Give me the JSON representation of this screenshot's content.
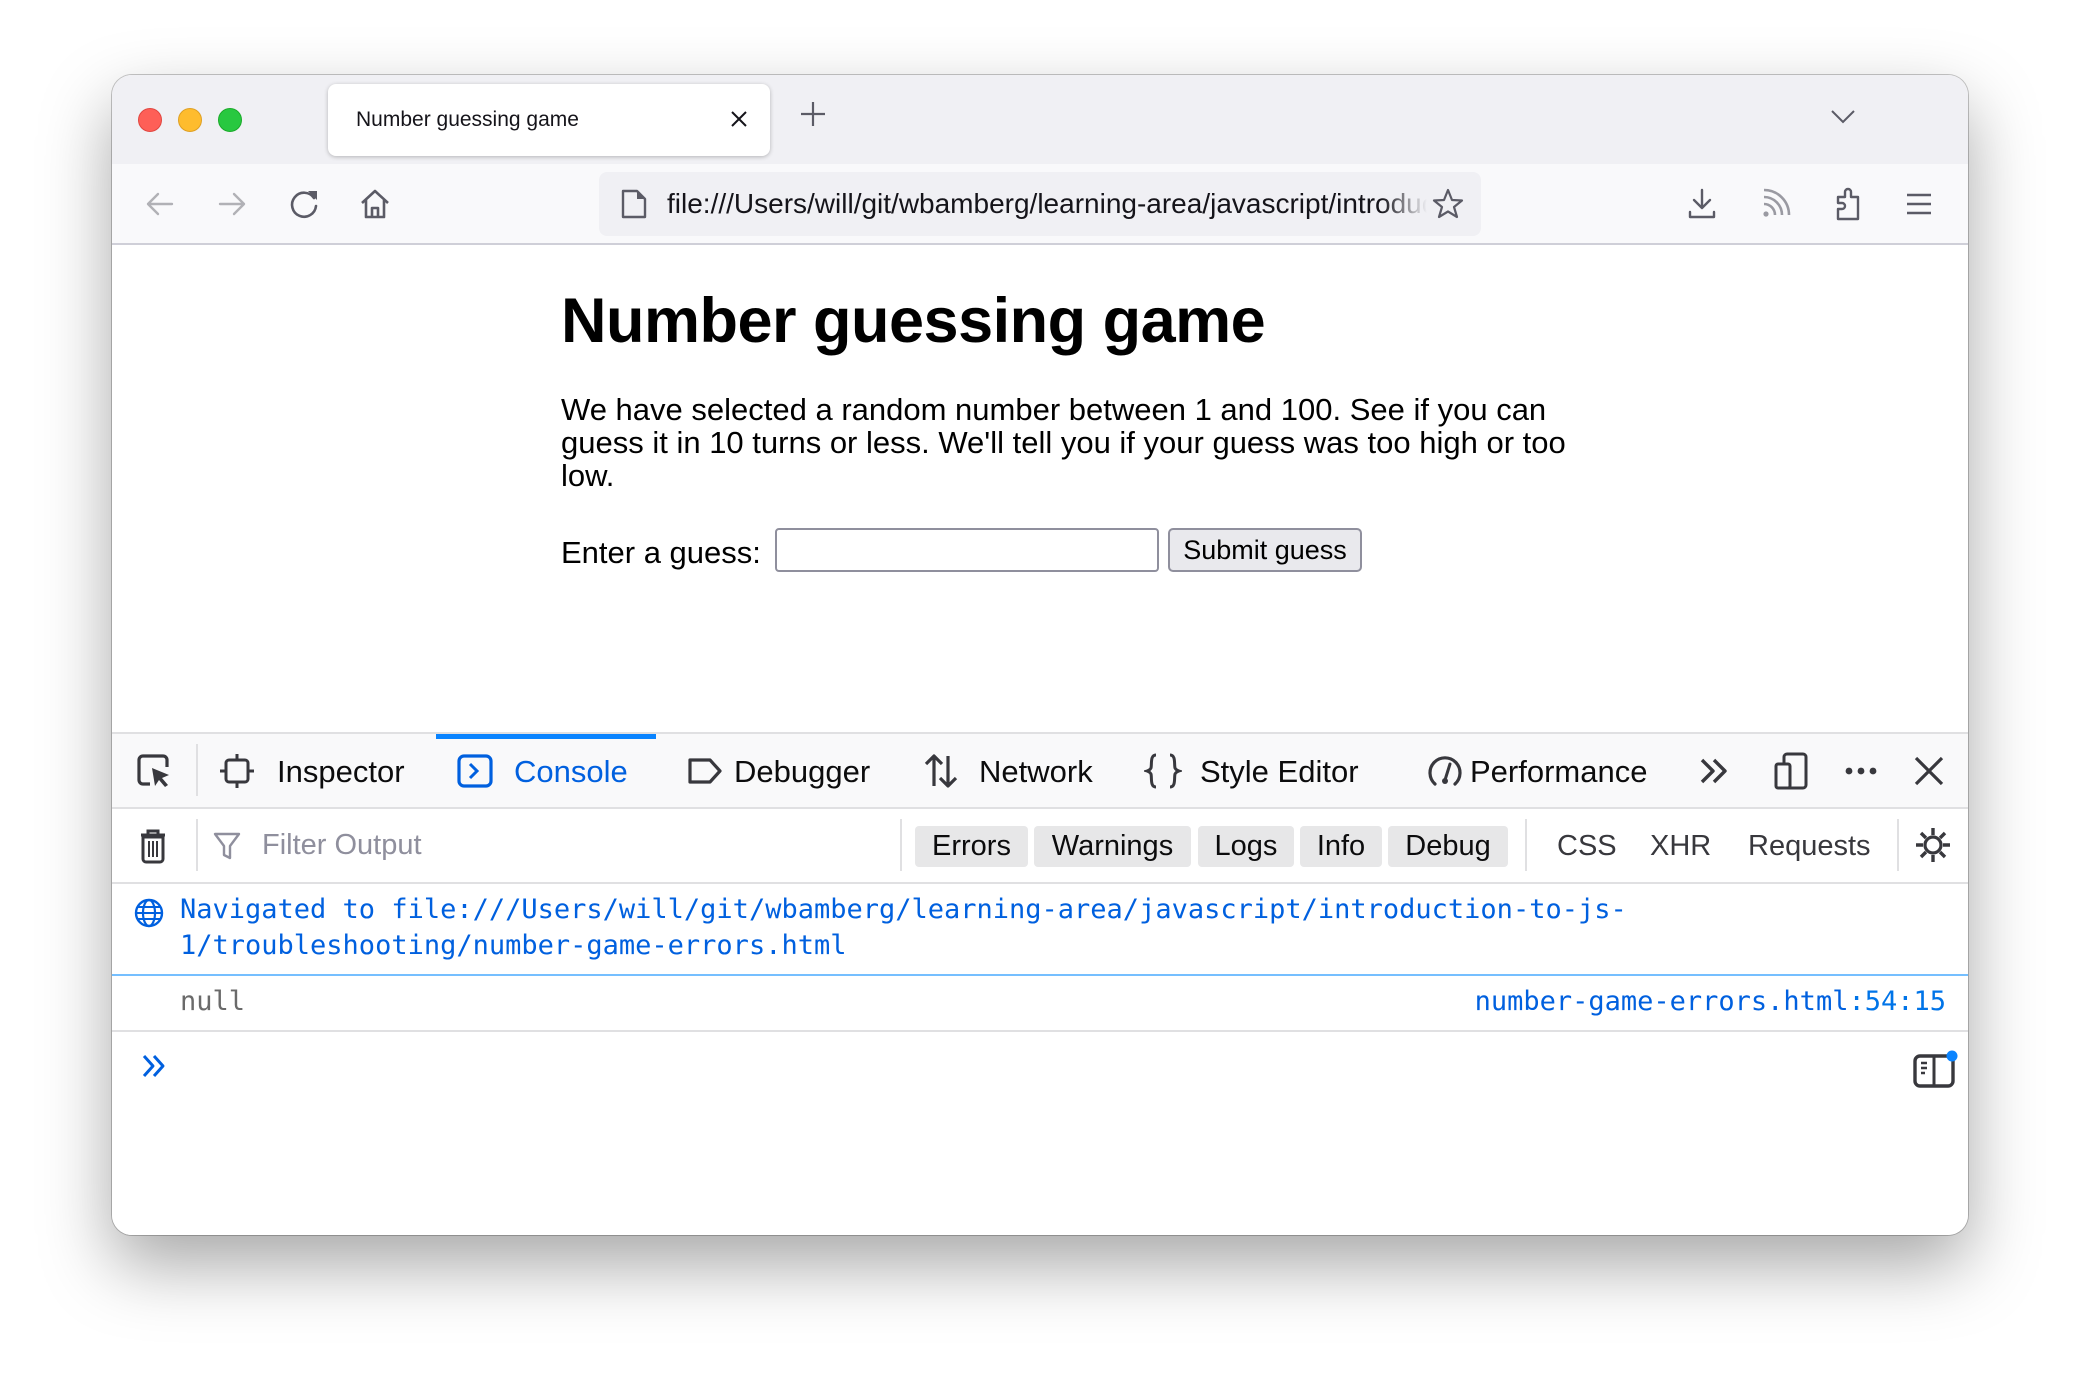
{
  "browser": {
    "tab": {
      "title": "Number guessing game"
    },
    "url": "file:///Users/will/git/wbamberg/learning-area/javascript/introduction-to-js-1/troubleshooting/number-game-errors.html"
  },
  "page": {
    "heading": "Number guessing game",
    "paragraph": "We have selected a random number between 1 and 100. See if you can guess it in 10 turns or less. We'll tell you if your guess was too high or too low.",
    "guess_label": "Enter a guess:",
    "guess_value": "",
    "submit_label": "Submit guess"
  },
  "devtools": {
    "tabs": [
      {
        "label": "Inspector",
        "icon": "inspector-icon",
        "active": false
      },
      {
        "label": "Console",
        "icon": "console-icon",
        "active": true
      },
      {
        "label": "Debugger",
        "icon": "debugger-icon",
        "active": false
      },
      {
        "label": "Network",
        "icon": "network-icon",
        "active": false
      },
      {
        "label": "Style Editor",
        "icon": "style-editor-icon",
        "active": false
      },
      {
        "label": "Performance",
        "icon": "performance-icon",
        "active": false
      }
    ],
    "filter": {
      "placeholder": "Filter Output",
      "levels": [
        "Errors",
        "Warnings",
        "Logs",
        "Info",
        "Debug"
      ],
      "types": [
        "CSS",
        "XHR",
        "Requests"
      ]
    },
    "console": {
      "navigation_message": "Navigated to file:///Users/will/git/wbamberg/learning-area/javascript/introduction-to-js-1/troubleshooting/number-game-errors.html",
      "log_value": "null",
      "log_source_file": "number-game-errors.html",
      "log_source_line": ":54:15"
    }
  },
  "colors": {
    "accent": "#0a84ff",
    "link": "#0060df"
  }
}
